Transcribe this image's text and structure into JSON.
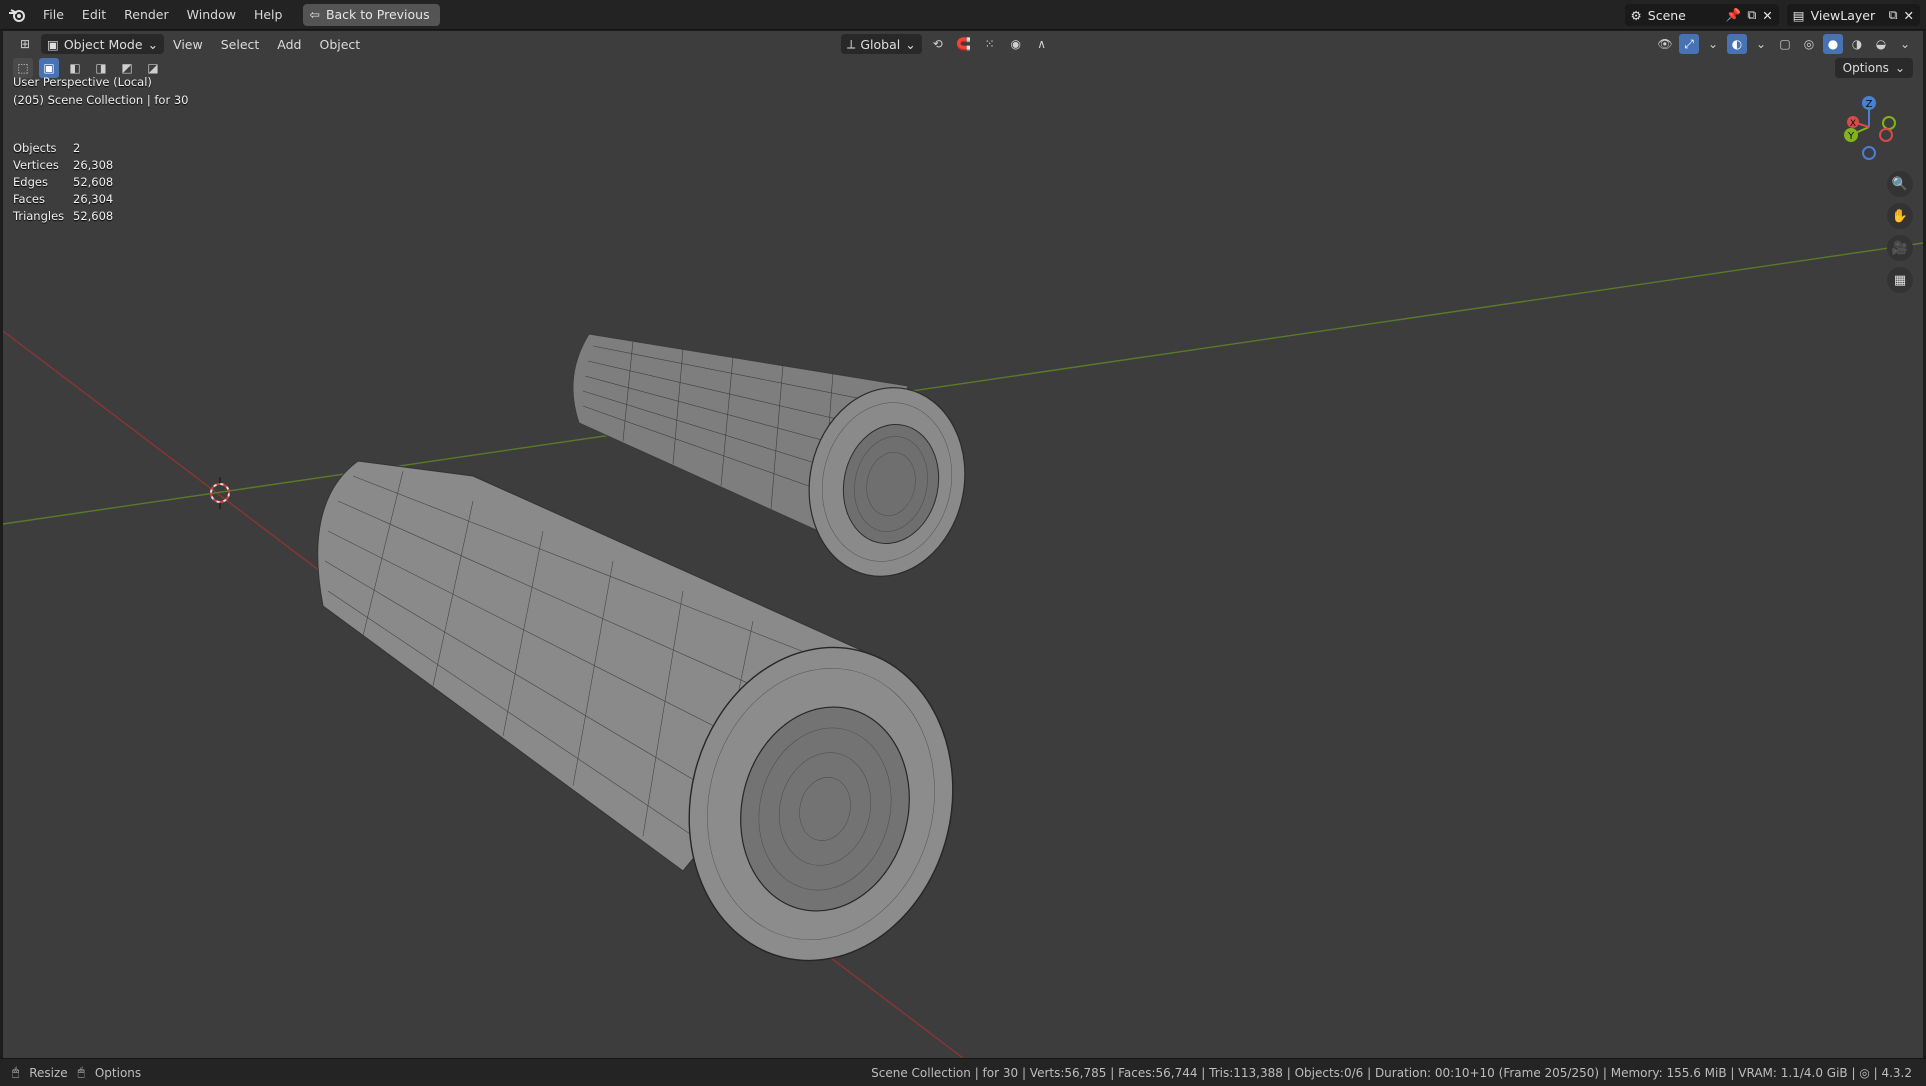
{
  "topbar": {
    "menu": [
      "File",
      "Edit",
      "Render",
      "Window",
      "Help"
    ],
    "back_button": "Back to Previous",
    "scene_name": "Scene",
    "view_layer": "ViewLayer"
  },
  "viewport_header": {
    "mode": "Object Mode",
    "menu": [
      "View",
      "Select",
      "Add",
      "Object"
    ],
    "orientation": "Global",
    "options_label": "Options"
  },
  "overlay": {
    "perspective": "User Perspective (Local)",
    "collection": "(205) Scene Collection | for 30"
  },
  "stats": [
    {
      "label": "Objects",
      "value": "2"
    },
    {
      "label": "Vertices",
      "value": "26,308"
    },
    {
      "label": "Edges",
      "value": "52,608"
    },
    {
      "label": "Faces",
      "value": "26,304"
    },
    {
      "label": "Triangles",
      "value": "52,608"
    }
  ],
  "gizmo": {
    "x": "X",
    "y": "Y",
    "z": "Z"
  },
  "statusbar": {
    "resize": "Resize",
    "options": "Options",
    "info": "Scene Collection | for 30 | Verts:56,785 | Faces:56,744 | Tris:113,388 | Objects:0/6 | Duration: 00:10+10 (Frame 205/250) | Memory: 155.6 MiB | VRAM: 1.1/4.0 GiB | ◎ | 4.3.2"
  },
  "colors": {
    "accent": "#4772b3",
    "x_axis": "#9b3434",
    "y_axis": "#5f7a2c",
    "mesh": "#8e8e8e"
  }
}
